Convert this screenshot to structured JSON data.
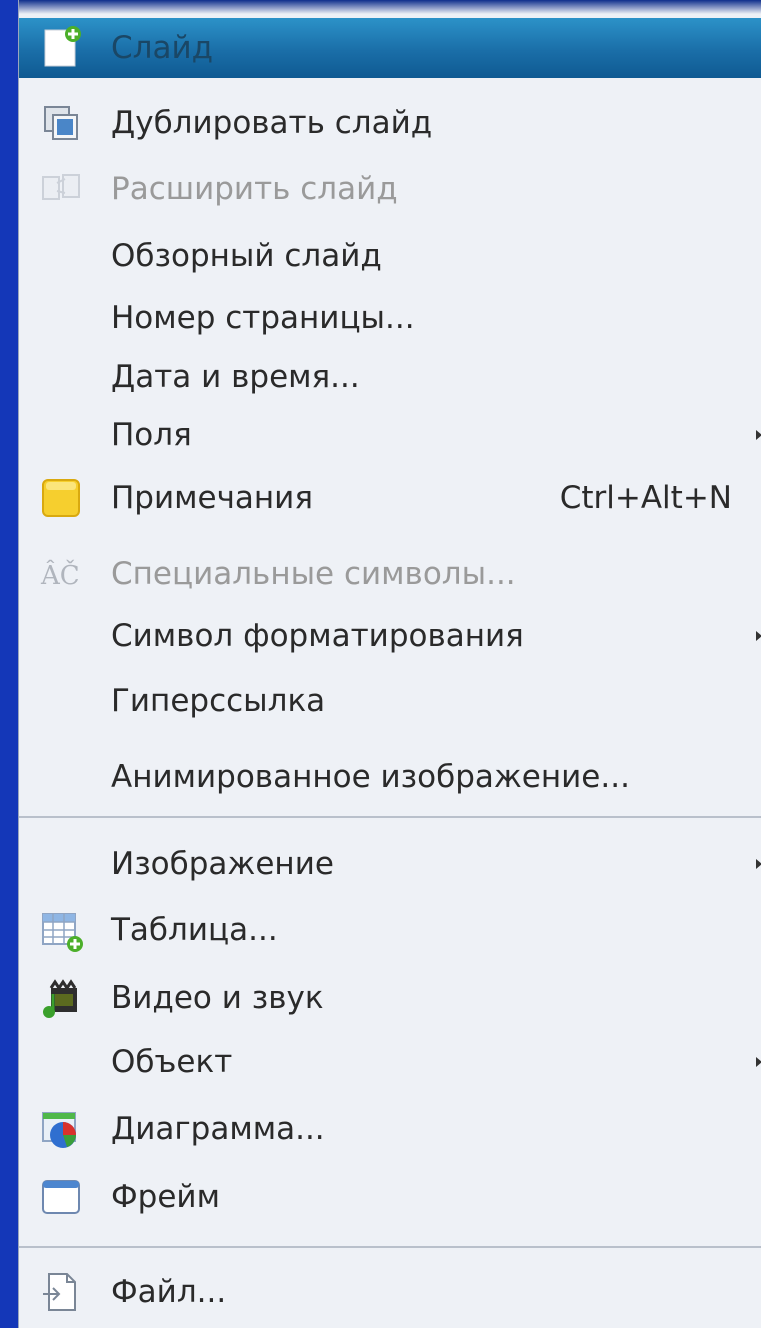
{
  "menu": {
    "items": [
      {
        "label": "Слайд",
        "icon": "new-slide-icon",
        "state": "highlighted"
      },
      {
        "label": "Дублировать слайд",
        "icon": "duplicate-slide-icon",
        "state": "normal"
      },
      {
        "label": "Расширить слайд",
        "icon": "expand-slide-icon",
        "state": "disabled"
      },
      {
        "label": "Обзорный слайд",
        "state": "normal"
      },
      {
        "label": "Номер страницы...",
        "state": "normal"
      },
      {
        "label": "Дата и время...",
        "state": "normal"
      },
      {
        "label": "Поля",
        "state": "normal",
        "submenu": true
      },
      {
        "label": "Примечания",
        "icon": "comment-note-icon",
        "shortcut": "Ctrl+Alt+N",
        "state": "normal"
      },
      {
        "label": "Специальные символы...",
        "icon": "special-characters-icon",
        "state": "disabled"
      },
      {
        "label": "Символ форматирования",
        "state": "normal",
        "submenu": true
      },
      {
        "label": "Гиперссылка",
        "state": "normal"
      },
      {
        "label": "Анимированное изображение...",
        "state": "normal"
      },
      {
        "label": "Изображение",
        "state": "normal",
        "submenu": true
      },
      {
        "label": "Таблица...",
        "icon": "table-icon",
        "state": "normal"
      },
      {
        "label": "Видео и звук",
        "icon": "video-sound-icon",
        "state": "normal"
      },
      {
        "label": "Объект",
        "state": "normal",
        "submenu": true
      },
      {
        "label": "Диаграмма...",
        "icon": "chart-icon",
        "state": "normal"
      },
      {
        "label": "Фрейм",
        "icon": "frame-icon",
        "state": "normal"
      },
      {
        "label": "Файл...",
        "icon": "file-icon",
        "state": "normal"
      }
    ]
  },
  "colors": {
    "background": "#1437b8",
    "menu_bg": "#eef1f6",
    "highlight": "#1a6ea8",
    "text": "#2a2a2a",
    "disabled_text": "#9a9a9a"
  }
}
